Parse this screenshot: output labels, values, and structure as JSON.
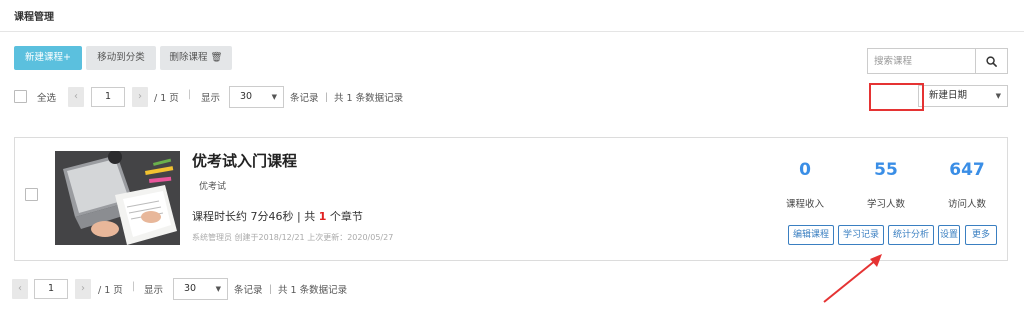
{
  "page_title": "课程管理",
  "toolbar": {
    "new_course": "新建课程+",
    "move_to_category": "移动到分类",
    "delete_course": "删除课程 🗑"
  },
  "search": {
    "placeholder": "搜索课程"
  },
  "top_pager": {
    "select_all": "全选",
    "page_value": "1",
    "page_total": "/ 1 页",
    "show_label": "显示",
    "per_page": "30",
    "records": "条记录 ｜ 共 1 条数据记录"
  },
  "sort": {
    "value": "新建日期"
  },
  "course": {
    "title": "优考试入门课程",
    "tag": "优考试",
    "duration_prefix": "课程时长约 7分46秒 | 共 ",
    "chapter_count": "1",
    "duration_suffix": " 个章节",
    "meta": "系统管理员 创建于2018/12/21 上次更新：2020/05/27",
    "stats": [
      {
        "value": "0",
        "label": "课程收入"
      },
      {
        "value": "55",
        "label": "学习人数"
      },
      {
        "value": "647",
        "label": "访问人数"
      }
    ],
    "actions": {
      "edit": "编辑课程",
      "records": "学习记录",
      "analytics": "统计分析",
      "settings": "设置",
      "more": "更多"
    }
  },
  "bottom_pager": {
    "page_value": "1",
    "page_total": "/ 1 页",
    "show_label": "显示",
    "per_page": "30",
    "records": "条记录 ｜ 共 1 条数据记录"
  },
  "colors": {
    "primary_button": "#5bc0de",
    "stat_number": "#3a8ee6",
    "action_border": "#3a7fc1",
    "highlight": "#e53333"
  }
}
